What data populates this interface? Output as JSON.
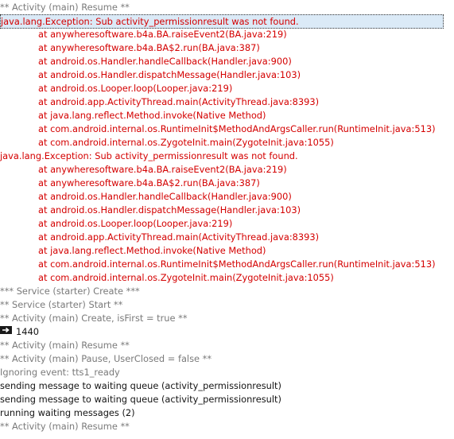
{
  "log": {
    "lines": [
      {
        "text": "** Activity (main) Resume **",
        "color": "gray"
      },
      {
        "text": "java.lang.Exception: Sub activity_permissionresult was not found.",
        "color": "red",
        "selected": true
      },
      {
        "text": "at anywheresoftware.b4a.BA.raiseEvent2(BA.java:219)",
        "color": "red",
        "indent": true
      },
      {
        "text": "at anywheresoftware.b4a.BA$2.run(BA.java:387)",
        "color": "red",
        "indent": true
      },
      {
        "text": "at android.os.Handler.handleCallback(Handler.java:900)",
        "color": "red",
        "indent": true
      },
      {
        "text": "at android.os.Handler.dispatchMessage(Handler.java:103)",
        "color": "red",
        "indent": true
      },
      {
        "text": "at android.os.Looper.loop(Looper.java:219)",
        "color": "red",
        "indent": true
      },
      {
        "text": "at android.app.ActivityThread.main(ActivityThread.java:8393)",
        "color": "red",
        "indent": true
      },
      {
        "text": "at java.lang.reflect.Method.invoke(Native Method)",
        "color": "red",
        "indent": true
      },
      {
        "text": "at com.android.internal.os.RuntimeInit$MethodAndArgsCaller.run(RuntimeInit.java:513)",
        "color": "red",
        "indent": true
      },
      {
        "text": "at com.android.internal.os.ZygoteInit.main(ZygoteInit.java:1055)",
        "color": "red",
        "indent": true
      },
      {
        "text": "java.lang.Exception: Sub activity_permissionresult was not found.",
        "color": "red"
      },
      {
        "text": "at anywheresoftware.b4a.BA.raiseEvent2(BA.java:219)",
        "color": "red",
        "indent": true
      },
      {
        "text": "at anywheresoftware.b4a.BA$2.run(BA.java:387)",
        "color": "red",
        "indent": true
      },
      {
        "text": "at android.os.Handler.handleCallback(Handler.java:900)",
        "color": "red",
        "indent": true
      },
      {
        "text": "at android.os.Handler.dispatchMessage(Handler.java:103)",
        "color": "red",
        "indent": true
      },
      {
        "text": "at android.os.Looper.loop(Looper.java:219)",
        "color": "red",
        "indent": true
      },
      {
        "text": "at android.app.ActivityThread.main(ActivityThread.java:8393)",
        "color": "red",
        "indent": true
      },
      {
        "text": "at java.lang.reflect.Method.invoke(Native Method)",
        "color": "red",
        "indent": true
      },
      {
        "text": "at com.android.internal.os.RuntimeInit$MethodAndArgsCaller.run(RuntimeInit.java:513)",
        "color": "red",
        "indent": true
      },
      {
        "text": "at com.android.internal.os.ZygoteInit.main(ZygoteInit.java:1055)",
        "color": "red",
        "indent": true
      },
      {
        "text": "*** Service (starter) Create ***",
        "color": "gray"
      },
      {
        "text": "** Service (starter) Start **",
        "color": "gray"
      },
      {
        "text": "** Activity (main) Create, isFirst = true **",
        "color": "gray"
      },
      {
        "text": "1440",
        "color": "black",
        "icon": "arrow-right-icon"
      },
      {
        "text": "** Activity (main) Resume **",
        "color": "gray"
      },
      {
        "text": "** Activity (main) Pause, UserClosed = false **",
        "color": "gray"
      },
      {
        "text": "Ignoring event: tts1_ready",
        "color": "gray"
      },
      {
        "text": "sending message to waiting queue (activity_permissionresult)",
        "color": "black"
      },
      {
        "text": "sending message to waiting queue (activity_permissionresult)",
        "color": "black"
      },
      {
        "text": "running waiting messages (2)",
        "color": "black"
      },
      {
        "text": "** Activity (main) Resume **",
        "color": "gray"
      }
    ]
  },
  "colors": {
    "gray": "#7a7a7a",
    "red": "#d40000",
    "black": "#141414",
    "selection": "#dbeaf7"
  }
}
